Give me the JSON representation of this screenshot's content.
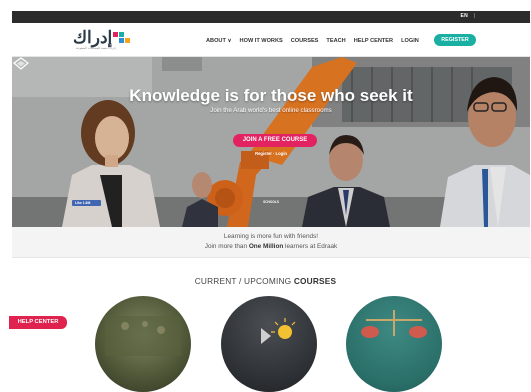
{
  "topbar": {
    "language": "EN",
    "separator": "|"
  },
  "brand": {
    "logo_text": "إدراك",
    "logo_subtext": "EDRAAK",
    "logo_tagline": "إدراك منصة للمساقات المفتوحة"
  },
  "nav": {
    "items": [
      "ABOUT ∨",
      "HOW IT WORKS",
      "COURSES",
      "TEACH",
      "HELP CENTER",
      "LOGIN"
    ],
    "register_label": "REGISTER"
  },
  "hero": {
    "title": "Knowledge is for those who seek it",
    "subtitle": "Join the Arab world's best online classrooms",
    "cta_label": "JOIN A FREE COURSE",
    "cta_links": "Register · Login",
    "schools_label": "SCHOOLS",
    "fb_like_label": "Like 1.6M"
  },
  "tagline": {
    "line1": "Learning is more fun with friends!",
    "line2_prefix": "Join more than ",
    "line2_bold": "One Million",
    "line2_suffix": " learners at Edraak"
  },
  "courses": {
    "title_prefix": "CURRENT / UPCOMING ",
    "title_bold": "COURSES"
  },
  "help_tab": {
    "label": "HELP CENTER"
  },
  "colors": {
    "accent_teal": "#19b0a3",
    "accent_pink": "#e32262",
    "topbar": "#2c2c2c"
  }
}
